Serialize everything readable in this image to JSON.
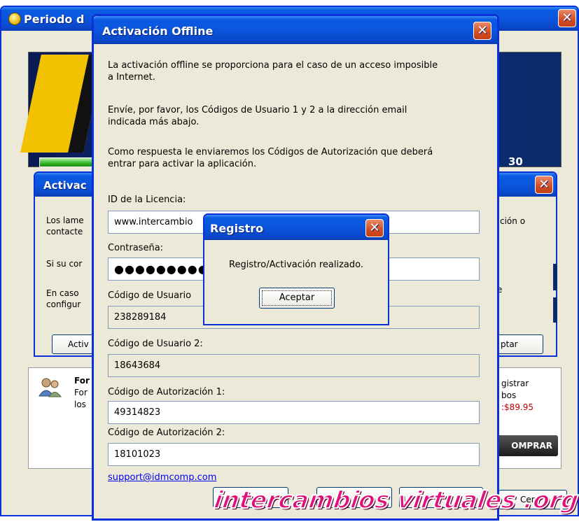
{
  "background_window": {
    "title": "Periodo d",
    "days_fragment": "30",
    "footer": {
      "heading": "For",
      "line2": "For",
      "line3": "los",
      "right_line1": "gistrar",
      "right_line2": "bos",
      "price": ":$89.95",
      "buy_label": "OMPRAR",
      "close_label": "Cer"
    }
  },
  "middle_window": {
    "title": "Activac",
    "lines": [
      "Los lame",
      "contacte",
      "Si su cor",
      "En caso",
      "configur"
    ],
    "right_text_top": "ción o",
    "right_text_mid": "e",
    "button_left": "Activ",
    "button_right": "ptar"
  },
  "offline_dialog": {
    "title": "Activación Offline",
    "paragraph1_line1": "La activación offline se proporciona para el caso de un acceso imposible",
    "paragraph1_line2": "a Internet.",
    "paragraph2_line1": "Envíe, por favor, los Códigos de Usuario 1 y 2 a la dirección email",
    "paragraph2_line2": "indicada más abajo.",
    "paragraph3_line1": "Como respuesta le enviaremos los Códigos de Autorización que deberá",
    "paragraph3_line2": "entrar para activar la aplicación.",
    "license_label": "ID de la Licencia:",
    "license_value": "www.intercambio",
    "password_label": "Contraseña:",
    "password_value": "●●●●●●●●●●●●",
    "user_code1_label": "Código de Usuario",
    "user_code1_value": "238289184",
    "user_code2_label": "Código de Usuario 2:",
    "user_code2_value": "18643684",
    "auth_code1_label": "Código de Autorización 1:",
    "auth_code1_value": "49314823",
    "auth_code2_label": "Código de Autorización 2:",
    "auth_code2_value": "18101023",
    "support_email": "support@idmcomp.com"
  },
  "registro_dialog": {
    "title": "Registro",
    "message": "Registro/Activación realizado.",
    "accept_label": "Aceptar"
  },
  "watermark": "intercambios virtuales .org",
  "colors": {
    "titlebar_blue": "#0a55dd",
    "window_face": "#ece9d8",
    "close_red": "#d34c22",
    "link_blue": "#0000ee",
    "price_red": "#c00000",
    "watermark_pink": "#e0107a"
  },
  "icons": {
    "title_icon": "app-icon",
    "close": "close-icon",
    "users": "users-icon"
  }
}
